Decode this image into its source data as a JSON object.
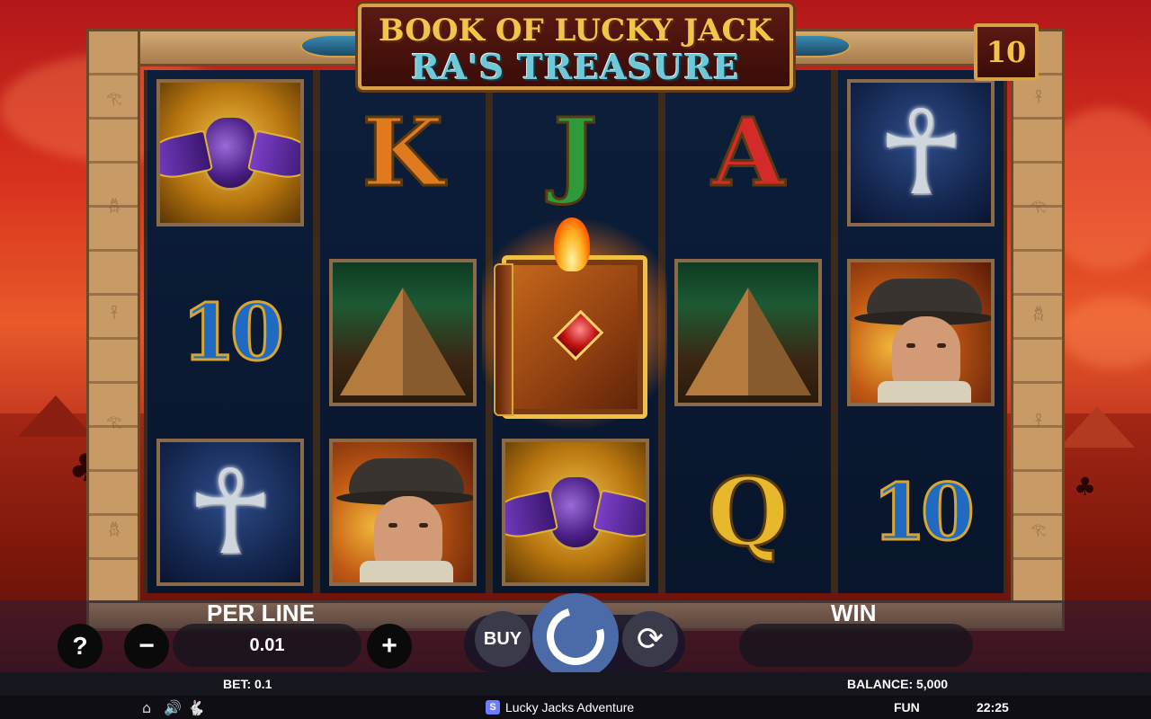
{
  "game": {
    "title_line1": "BOOK OF LUCKY JACK",
    "title_line2": "RA'S TREASURE",
    "paylines": "10"
  },
  "reels": [
    [
      "scarab",
      "ten",
      "ankh"
    ],
    [
      "K",
      "pyramid",
      "explorer"
    ],
    [
      "J",
      "book",
      "scarab"
    ],
    [
      "A",
      "pyramid",
      "Q"
    ],
    [
      "ankh",
      "explorer",
      "ten"
    ]
  ],
  "symbols": {
    "K": "K",
    "J": "J",
    "A": "A",
    "Q": "Q",
    "ten": "10"
  },
  "controls": {
    "help_label": "?",
    "per_line_label": "PER LINE",
    "per_line_value": "0.01",
    "minus_label": "−",
    "plus_label": "+",
    "buy_label": "BUY",
    "win_label": "WIN",
    "win_value": ""
  },
  "footer": {
    "bet": "BET: 0.1",
    "balance": "BALANCE: 5,000",
    "game_name": "Lucky Jacks Adventure",
    "mode": "FUN",
    "time": "22:25",
    "brand_glyph": "S"
  },
  "icons": {
    "home": "home-icon",
    "sound": "sound-icon",
    "turbo": "turbo-icon"
  },
  "colors": {
    "gold": "#f3c44a",
    "turquoise": "#6ec8d8",
    "spin_button": "#4a6aa8"
  }
}
